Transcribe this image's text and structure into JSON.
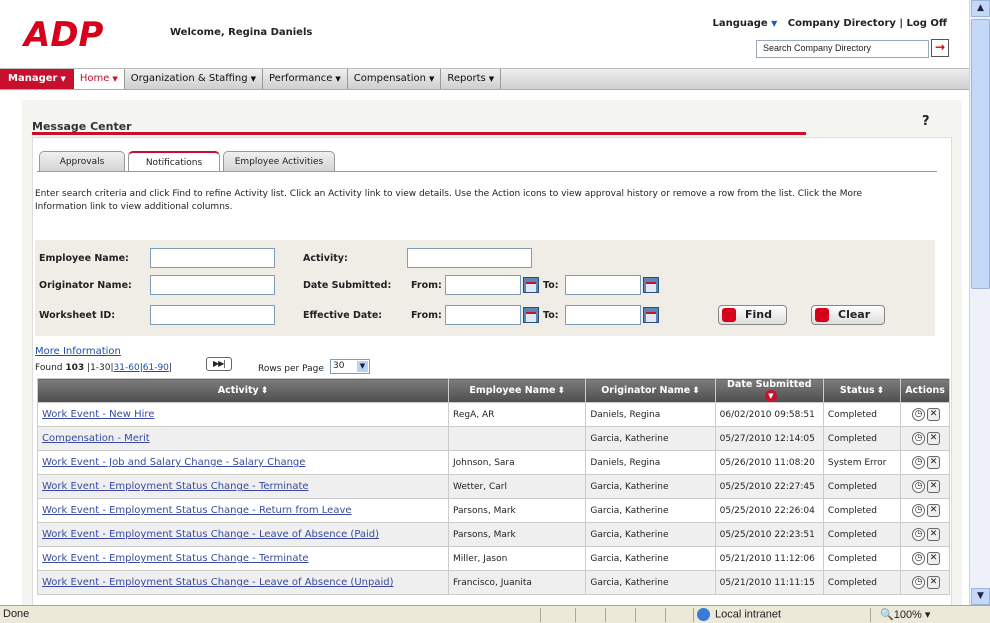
{
  "header": {
    "welcome": "Welcome, Regina Daniels",
    "language": "Language",
    "company_directory": "Company Directory",
    "log_off": "Log Off",
    "search_placeholder": "Search Company Directory"
  },
  "nav": {
    "manager": "Manager",
    "items": [
      "Home",
      "Organization & Staffing",
      "Performance",
      "Compensation",
      "Reports"
    ]
  },
  "page": {
    "title": "Message Center",
    "help": "?"
  },
  "tabs": [
    "Approvals",
    "Notifications",
    "Employee Activities"
  ],
  "instructions": "Enter search criteria and click Find to refine Activity list. Click an Activity link to view details. Use the Action icons to view approval history or remove a row from the list. Click the More Information link to view additional columns.",
  "criteria": {
    "employee_name": "Employee Name:",
    "activity": "Activity:",
    "originator_name": "Originator Name:",
    "date_submitted": "Date Submitted:",
    "worksheet_id": "Worksheet ID:",
    "effective_date": "Effective Date:",
    "from": "From:",
    "to": "To:",
    "find": "Find",
    "clear": "Clear"
  },
  "more_info": "More Information",
  "found": {
    "prefix": "Found",
    "count": "103",
    "range": "1-30",
    "link1": "31-60",
    "link2": "61-90",
    "rows_per_page": "Rows per Page",
    "rows_value": "30"
  },
  "table": {
    "headers": [
      "Activity",
      "Employee Name",
      "Originator Name",
      "Date Submitted",
      "Status",
      "Actions"
    ],
    "rows": [
      {
        "activity": "Work Event - New Hire",
        "employee": "RegA, AR",
        "originator": "Daniels, Regina",
        "date": "06/02/2010 09:58:51",
        "status": "Completed"
      },
      {
        "activity": "Compensation - Merit",
        "employee": "",
        "originator": "Garcia, Katherine",
        "date": "05/27/2010 12:14:05",
        "status": "Completed"
      },
      {
        "activity": "Work Event - Job and Salary Change - Salary Change",
        "employee": "Johnson, Sara",
        "originator": "Daniels, Regina",
        "date": "05/26/2010 11:08:20",
        "status": "System Error"
      },
      {
        "activity": "Work Event - Employment Status Change - Terminate",
        "employee": "Wetter, Carl",
        "originator": "Garcia, Katherine",
        "date": "05/25/2010 22:27:45",
        "status": "Completed"
      },
      {
        "activity": "Work Event - Employment Status Change - Return from Leave",
        "employee": "Parsons, Mark",
        "originator": "Garcia, Katherine",
        "date": "05/25/2010 22:26:04",
        "status": "Completed"
      },
      {
        "activity": "Work Event - Employment Status Change - Leave of Absence (Paid)",
        "employee": "Parsons, Mark",
        "originator": "Garcia, Katherine",
        "date": "05/25/2010 22:23:51",
        "status": "Completed"
      },
      {
        "activity": "Work Event - Employment Status Change - Terminate",
        "employee": "Miller, Jason",
        "originator": "Garcia, Katherine",
        "date": "05/21/2010 11:12:06",
        "status": "Completed"
      },
      {
        "activity": "Work Event - Employment Status Change - Leave of Absence (Unpaid)",
        "employee": "Francisco, Juanita",
        "originator": "Garcia, Katherine",
        "date": "05/21/2010 11:11:15",
        "status": "Completed"
      }
    ]
  },
  "statusbar": {
    "done": "Done",
    "zone": "Local intranet",
    "zoom": "100%"
  }
}
